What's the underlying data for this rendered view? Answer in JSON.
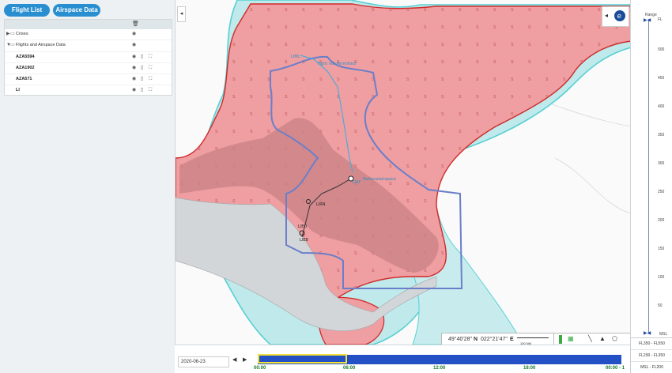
{
  "left_panel": {
    "flight_list_button": "Flight List",
    "airspace_data_button": "Airspace Data",
    "rows": [
      {
        "label": "Crises",
        "type": "group"
      },
      {
        "label": "Flights and Airspace Data",
        "type": "group"
      },
      {
        "label": "AZA5594",
        "type": "flight"
      },
      {
        "label": "AZA1902",
        "type": "flight"
      },
      {
        "label": "AZA571",
        "type": "flight"
      },
      {
        "label": "LI",
        "type": "flight"
      }
    ]
  },
  "map": {
    "labels": {
      "flight_note": "Fight not Permitted",
      "alt_note": "Nationalairspace",
      "lim": "LIML",
      "lirn": "LIRN",
      "lirf": "LIRF",
      "lieo": "LIEO",
      "lieb": "LIEB"
    },
    "coords_lat": "49°40'28\"",
    "coords_lat_dir": "N",
    "coords_lon": "022°21'47\"",
    "coords_lon_dir": "E",
    "scale_label": "100 NM",
    "colors": {
      "danger_fill": "#e88a8d",
      "danger_stroke": "#d02d2d",
      "buffer_cyan": "#58d0d3",
      "country_border": "#6a7fc9",
      "route": "#31b0df"
    }
  },
  "ruler": {
    "title": "Range",
    "top_value": "FL",
    "ticks": [
      "500",
      "450",
      "400",
      "350",
      "300",
      "250",
      "200",
      "150",
      "100",
      "50"
    ],
    "bottom_label": "MSL"
  },
  "fl_menu": [
    "FL350 - FL550",
    "FL200 - FL350",
    "MSL - FL200"
  ],
  "timeline": {
    "date": "2020-06-23",
    "labels": [
      "00:00",
      "06:00",
      "12:00",
      "18:00",
      "00:00 - 1"
    ]
  }
}
